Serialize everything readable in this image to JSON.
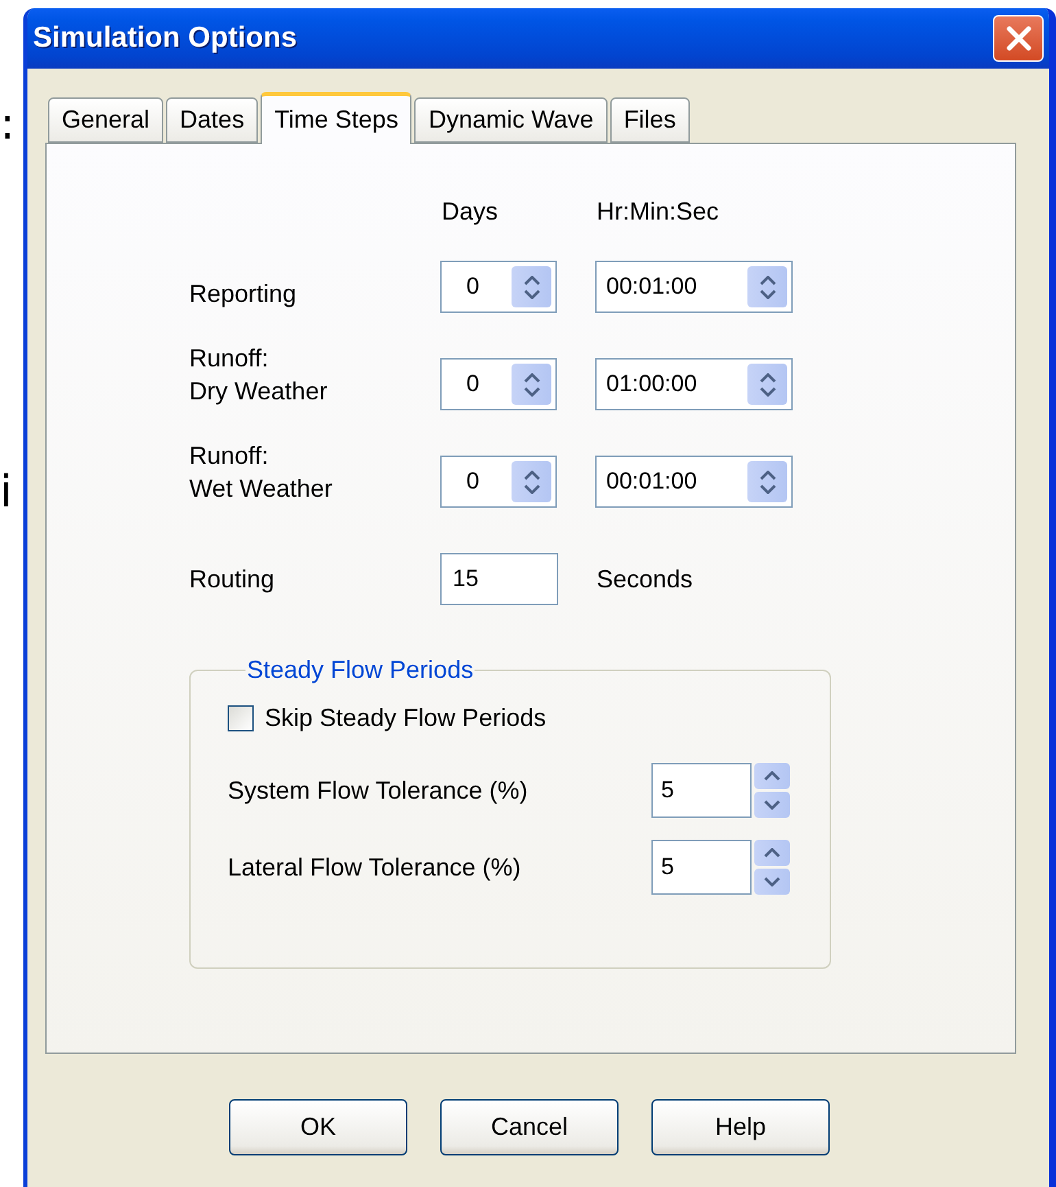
{
  "background_text": [
    ":",
    "i"
  ],
  "window": {
    "title": "Simulation Options"
  },
  "tabs": [
    {
      "label": "General",
      "selected": false
    },
    {
      "label": "Dates",
      "selected": false
    },
    {
      "label": "Time Steps",
      "selected": true
    },
    {
      "label": "Dynamic Wave",
      "selected": false
    },
    {
      "label": "Files",
      "selected": false
    }
  ],
  "time_steps": {
    "column_headers": [
      "Days",
      "Hr:Min:Sec"
    ],
    "rows": [
      {
        "label": "Reporting",
        "days": "0",
        "time": "00:01:00"
      },
      {
        "label": "Runoff:\nDry Weather",
        "days": "0",
        "time": "01:00:00"
      },
      {
        "label": "Runoff:\nWet Weather",
        "days": "0",
        "time": "00:01:00"
      }
    ],
    "routing": {
      "label": "Routing",
      "value": "15",
      "unit": "Seconds"
    }
  },
  "steady_flow": {
    "title": "Steady Flow Periods",
    "skip": {
      "label": "Skip Steady Flow Periods",
      "checked": false
    },
    "tolerances": [
      {
        "label": "System Flow Tolerance (%)",
        "value": "5"
      },
      {
        "label": "Lateral Flow Tolerance (%)",
        "value": "5"
      }
    ]
  },
  "buttons": [
    "OK",
    "Cancel",
    "Help"
  ]
}
